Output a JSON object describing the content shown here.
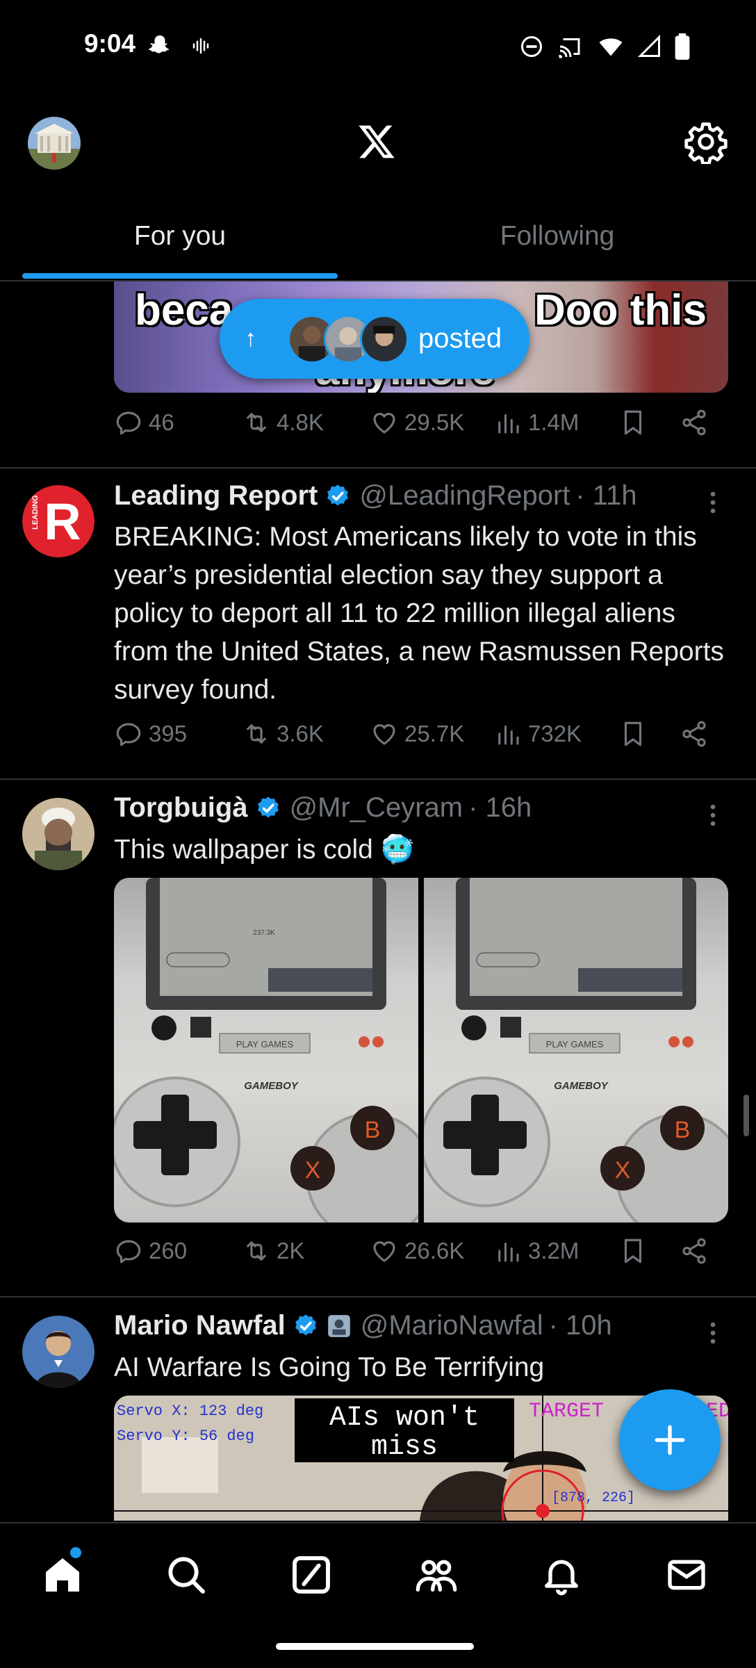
{
  "status_bar": {
    "time": "9:04"
  },
  "header": {
    "tabs": [
      {
        "label": "For you",
        "active": true
      },
      {
        "label": "Following",
        "active": false
      }
    ]
  },
  "pinned_fragment": {
    "meme_text_left": "beca",
    "meme_text_right": "Doo this",
    "meme_text_bottom": "anymore",
    "stats": {
      "replies": "46",
      "reposts": "4.8K",
      "likes": "29.5K",
      "views": "1.4M"
    }
  },
  "new_posts_pill": {
    "label": "posted"
  },
  "posts": [
    {
      "name": "Leading Report",
      "handle": "@LeadingReport",
      "time": "· 11h",
      "text": "BREAKING: Most Americans likely to vote in this year’s presidential election say they support a policy to deport all 11 to 22 million illegal aliens from the United States, a new Rasmussen Reports survey found.",
      "stats": {
        "replies": "395",
        "reposts": "3.6K",
        "likes": "25.7K",
        "views": "732K"
      },
      "avatar_color": "#e0222d"
    },
    {
      "name": "Torgbuigà",
      "handle": "@Mr_Ceyram",
      "time": "· 16h",
      "text": "This wallpaper is cold 🥶",
      "stats": {
        "replies": "260",
        "reposts": "2K",
        "likes": "26.6K",
        "views": "3.2M"
      },
      "image_labels": {
        "play_games": "PLAY GAMES",
        "brand": "GAMEBOY",
        "button_b": "B",
        "button_x": "X",
        "count": "237.3K"
      }
    },
    {
      "name": "Mario Nawfal",
      "handle": "@MarioNawfal",
      "time": "· 10h",
      "text": "AI Warfare Is Going To Be Terrifying",
      "image_labels": {
        "servo_x": "Servo X: 123 deg",
        "servo_y": "Servo Y: 56 deg",
        "caption": "AIs won't miss",
        "target": "TARGET",
        "target_suffix": "ED",
        "coords": "[878, 226]"
      }
    }
  ],
  "colors": {
    "accent": "#1d9bf0",
    "background": "#000000",
    "text_primary": "#e7e9ea",
    "text_secondary": "#71767b",
    "divider": "#2f3336"
  },
  "bottom_nav": {
    "items": [
      "home-icon",
      "search-icon",
      "grok-icon",
      "communities-icon",
      "notifications-icon",
      "messages-icon"
    ]
  }
}
